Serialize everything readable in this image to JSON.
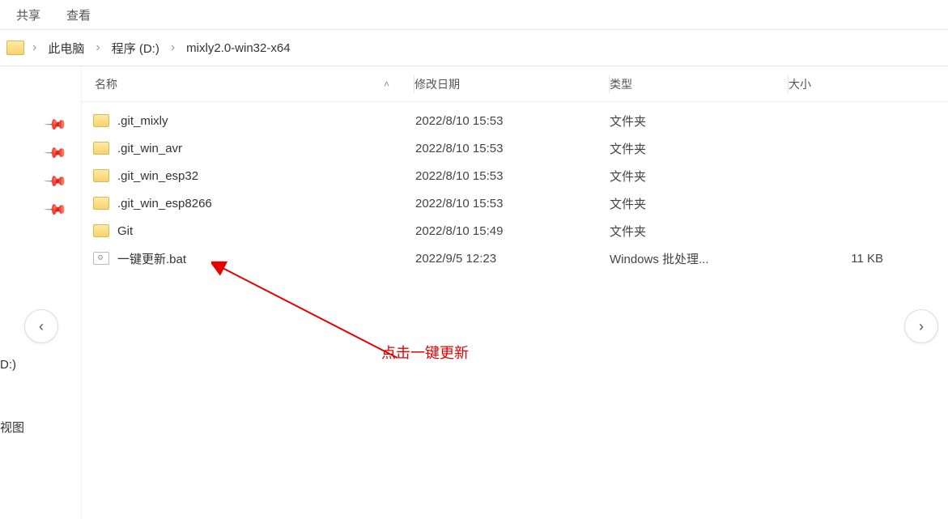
{
  "tabs": {
    "share": "共享",
    "view": "查看"
  },
  "breadcrumb": {
    "this_pc": "此电脑",
    "drive": "程序 (D:)",
    "folder": "mixly2.0-win32-x64"
  },
  "sidebar": {
    "drive_label": "D:)",
    "view_label": "视图"
  },
  "columns": {
    "name": "名称",
    "date": "修改日期",
    "type": "类型",
    "size": "大小"
  },
  "files": [
    {
      "name": ".git_mixly",
      "date": "2022/8/10 15:53",
      "type": "文件夹",
      "size": "",
      "icon": "folder"
    },
    {
      "name": ".git_win_avr",
      "date": "2022/8/10 15:53",
      "type": "文件夹",
      "size": "",
      "icon": "folder"
    },
    {
      "name": ".git_win_esp32",
      "date": "2022/8/10 15:53",
      "type": "文件夹",
      "size": "",
      "icon": "folder"
    },
    {
      "name": ".git_win_esp8266",
      "date": "2022/8/10 15:53",
      "type": "文件夹",
      "size": "",
      "icon": "folder"
    },
    {
      "name": "Git",
      "date": "2022/8/10 15:49",
      "type": "文件夹",
      "size": "",
      "icon": "folder"
    },
    {
      "name": "一键更新.bat",
      "date": "2022/9/5 12:23",
      "type": "Windows 批处理...",
      "size": "11 KB",
      "icon": "bat"
    }
  ],
  "annotation": "点击一键更新"
}
